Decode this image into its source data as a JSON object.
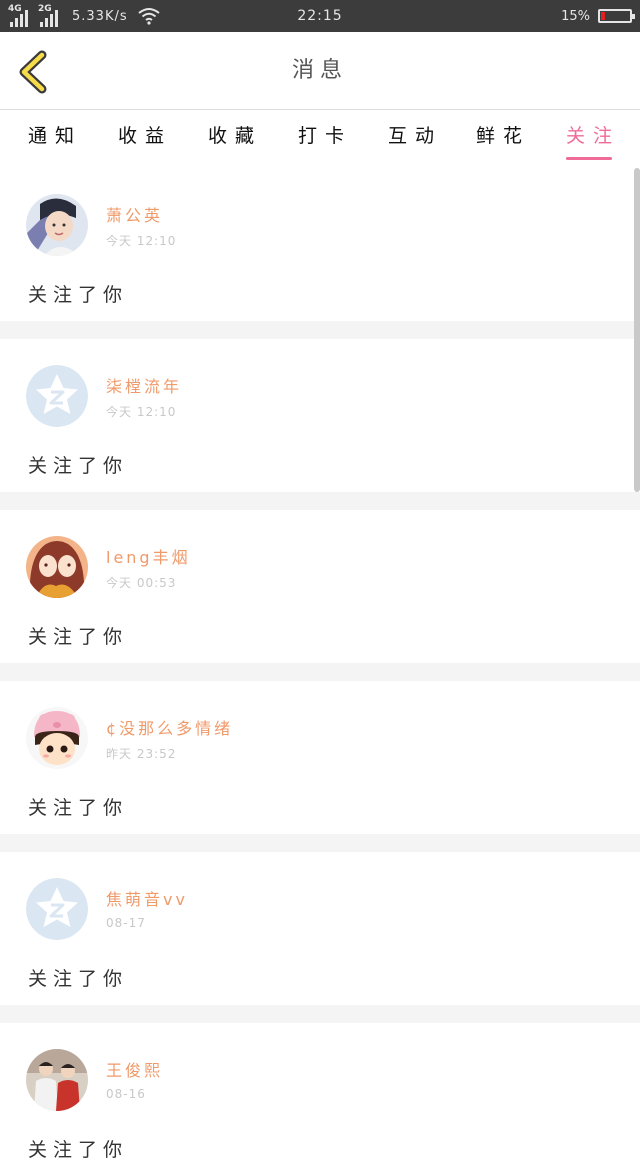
{
  "status_bar": {
    "net1": "4G",
    "net2": "2G",
    "speed": "5.33K/s",
    "time": "22:15",
    "battery_percent": "15%",
    "battery_level": 0.15,
    "battery_color": "#e02020"
  },
  "header": {
    "back_icon": "chevron-left-icon",
    "title": "消息"
  },
  "tabs": [
    {
      "label": "通知",
      "active": false
    },
    {
      "label": "收益",
      "active": false
    },
    {
      "label": "收藏",
      "active": false
    },
    {
      "label": "打卡",
      "active": false
    },
    {
      "label": "互动",
      "active": false
    },
    {
      "label": "鲜花",
      "active": false
    },
    {
      "label": "关注",
      "active": true
    }
  ],
  "accent_color": "#ee6c97",
  "name_color": "#f09a6a",
  "messages": [
    {
      "name": "萧公英",
      "time": "今天 12:10",
      "text": "关注了你",
      "avatar": "photo-girl-avatar"
    },
    {
      "name": "柒樘流年",
      "time": "今天 12:10",
      "text": "关注了你",
      "avatar": "default-star-avatar"
    },
    {
      "name": "leng丰烟",
      "time": "今天 00:53",
      "text": "关注了你",
      "avatar": "anime-girl-avatar"
    },
    {
      "name": "¢没那么多情绪",
      "time": "昨天 23:52",
      "text": "关注了你",
      "avatar": "cartoon-bunny-avatar"
    },
    {
      "name": "焦萌音vv",
      "time": "08-17",
      "text": "关注了你",
      "avatar": "default-star-avatar"
    },
    {
      "name": "王俊熙",
      "time": "08-16",
      "text": "关注了你",
      "avatar": "photo-group-avatar"
    }
  ]
}
